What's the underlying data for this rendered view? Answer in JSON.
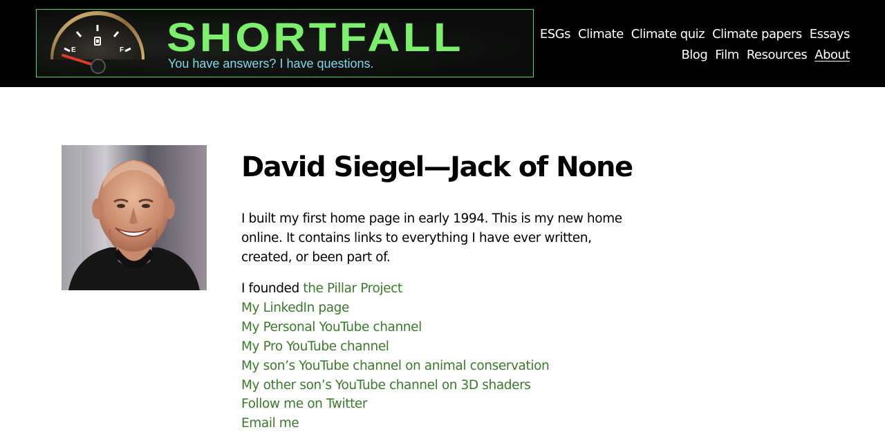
{
  "header": {
    "logo": {
      "title": "SHORTFALL",
      "tagline": "You have answers? I have questions.",
      "gauge_empty_label": "E",
      "gauge_full_label": "F"
    },
    "nav": {
      "row1": [
        {
          "label": "ESGs"
        },
        {
          "label": "Climate"
        },
        {
          "label": "Climate quiz"
        },
        {
          "label": "Climate papers"
        },
        {
          "label": "Essays"
        }
      ],
      "row2": [
        {
          "label": "Blog"
        },
        {
          "label": "Film"
        },
        {
          "label": "Resources"
        },
        {
          "label": "About"
        }
      ],
      "active": "About"
    }
  },
  "main": {
    "title": "David Siegel—Jack of None",
    "intro": "I built my first home page in early 1994. This is my new home online. It contains links to everything I have ever written, created, or been part of.",
    "founded_prefix": "I founded ",
    "founded_link": "the Pillar Project",
    "links": [
      "My LinkedIn page",
      "My Personal YouTube channel",
      "My Pro YouTube channel",
      "My son’s YouTube channel on animal conservation",
      "My other son’s YouTube channel on 3D shaders",
      "Follow me on Twitter",
      "Email me"
    ]
  },
  "colors": {
    "header_bg": "#000000",
    "logo_green": "#7cf06c",
    "tagline_cyan": "#7fd9e6",
    "link_green": "#3a7a2a",
    "nav_text": "#ffffff"
  }
}
